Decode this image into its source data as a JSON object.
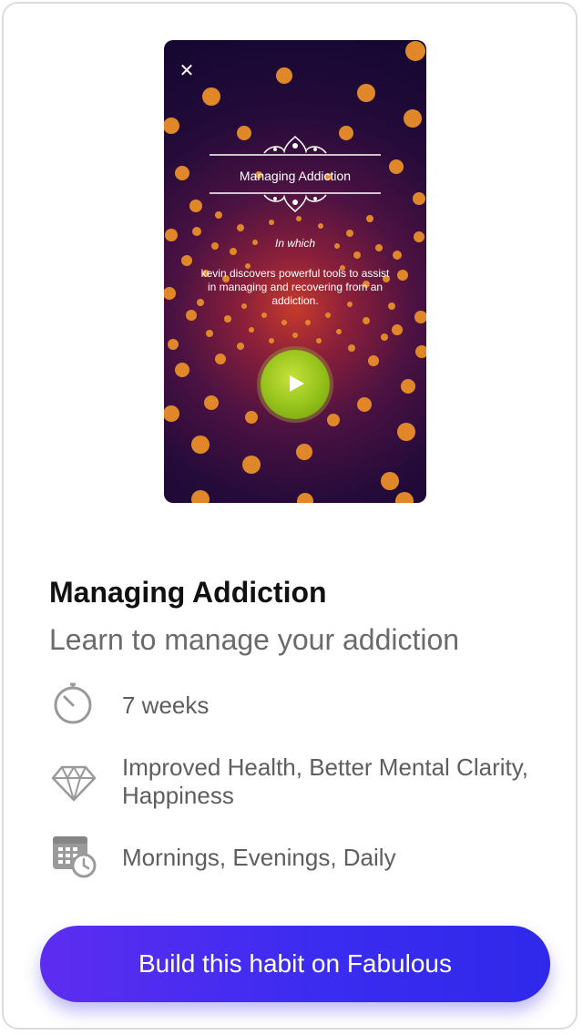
{
  "preview": {
    "close_icon": "close-icon",
    "title": "Managing Addiction",
    "in_which": "In which",
    "description": "kevin discovers powerful tools to assist in managing and recovering from an addiction.",
    "play_icon": "play-icon",
    "colors": {
      "background_center": "#c63a2c",
      "background_edge": "#130730",
      "dots": "#e0872a",
      "play_button": "#93c11a"
    }
  },
  "habit": {
    "title": "Managing Addiction",
    "subtitle": "Learn to manage your addiction"
  },
  "features": [
    {
      "icon": "stopwatch-icon",
      "text": "7 weeks"
    },
    {
      "icon": "diamond-icon",
      "text": "Improved Health, Better Mental Clarity, Happiness"
    },
    {
      "icon": "calendar-clock-icon",
      "text": "Mornings, Evenings, Daily"
    }
  ],
  "cta": {
    "label": "Build this habit on Fabulous",
    "color": "#3b2cf0"
  }
}
